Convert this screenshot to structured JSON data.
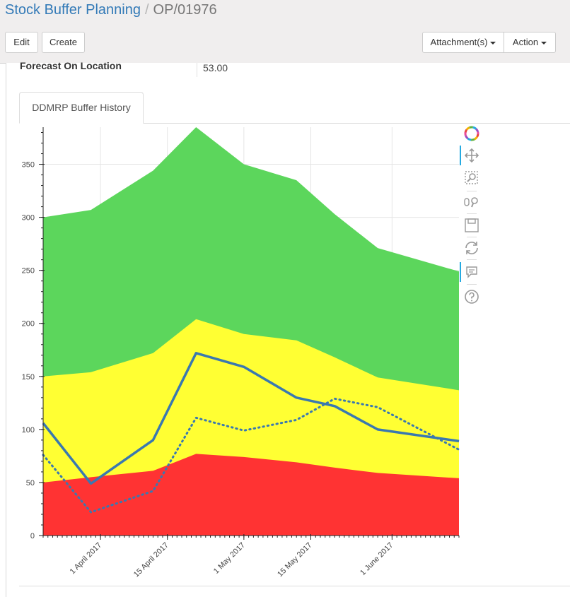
{
  "breadcrumb": {
    "parent": "Stock Buffer Planning",
    "separator": "/",
    "current": "OP/01976"
  },
  "buttons": {
    "edit": "Edit",
    "create": "Create",
    "attachments": "Attachment(s)",
    "action": "Action"
  },
  "form": {
    "forecast_label": "Forecast On Location",
    "forecast_value": "53.00"
  },
  "tab": {
    "label": "DDMRP Buffer History"
  },
  "toolbar": {
    "icons": [
      "bokeh-logo-icon",
      "pan-icon",
      "box-zoom-icon",
      "wheel-zoom-icon",
      "save-icon",
      "reset-icon",
      "hover-icon",
      "help-icon"
    ]
  },
  "colors": {
    "link": "#337ab7",
    "red_zone": "#ff3333",
    "yellow_zone": "#ffff33",
    "green_zone": "#5cd65c",
    "series_line": "#3a78b0"
  },
  "chart_data": {
    "type": "area",
    "title": "",
    "xlabel": "",
    "ylabel": "",
    "ylim": [
      0,
      385
    ],
    "y_ticks": [
      "0",
      "50",
      "100",
      "150",
      "200",
      "250",
      "300",
      "350"
    ],
    "x_range": [
      "2017-03-20",
      "2017-06-15"
    ],
    "x_ticks": [
      {
        "date": "2017-04-01",
        "label": "1 April 2017"
      },
      {
        "date": "2017-04-15",
        "label": "15 April 2017"
      },
      {
        "date": "2017-05-01",
        "label": "1 May 2017"
      },
      {
        "date": "2017-05-15",
        "label": "15 May 2017"
      },
      {
        "date": "2017-06-01",
        "label": "1 June 2017"
      }
    ],
    "dates": [
      "2017-03-20",
      "2017-03-30",
      "2017-04-12",
      "2017-04-21",
      "2017-05-01",
      "2017-05-12",
      "2017-05-20",
      "2017-05-29",
      "2017-06-15"
    ],
    "series": [
      {
        "kind": "area",
        "color": "#ff3333",
        "values": [
          50,
          55,
          61,
          77,
          74,
          69,
          64,
          59,
          54
        ]
      },
      {
        "kind": "area",
        "color": "#ffff33",
        "values": [
          150,
          154,
          172,
          204,
          190,
          184,
          168,
          149,
          137
        ]
      },
      {
        "kind": "area",
        "color": "#5cd65c",
        "values": [
          300,
          307,
          344,
          385,
          350,
          335,
          303,
          271,
          249
        ]
      },
      {
        "kind": "line",
        "style": "solid",
        "color": "#3a78b0",
        "values": [
          106,
          49,
          90,
          172,
          159,
          130,
          122,
          100,
          89
        ]
      },
      {
        "kind": "line",
        "style": "dotted",
        "color": "#3a78b0",
        "values": [
          76,
          22,
          42,
          111,
          99,
          109,
          129,
          121,
          81
        ]
      }
    ],
    "grid": true,
    "legend": "none"
  }
}
